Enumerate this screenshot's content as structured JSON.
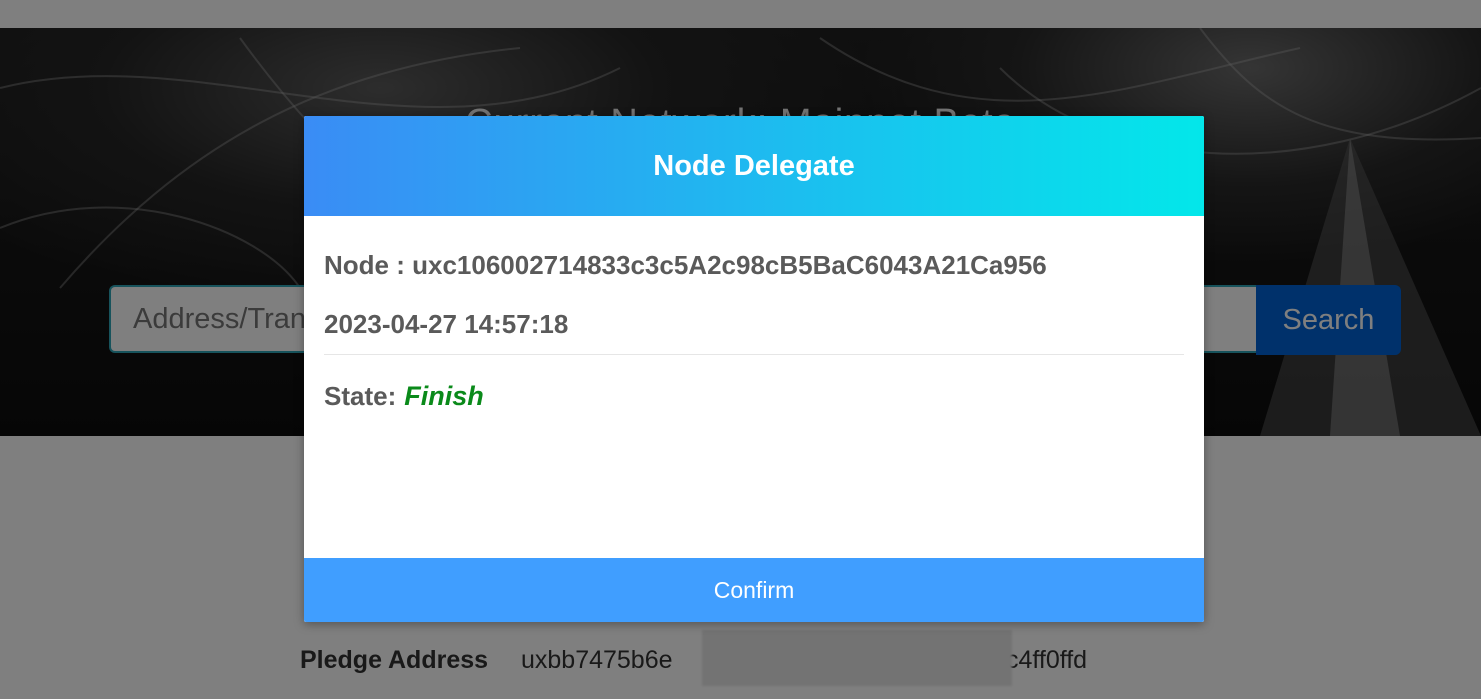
{
  "hero": {
    "title": "Current Network: Mainnet Beta"
  },
  "search": {
    "placeholder": "Address/Transaction Hash/Block Height",
    "button_label": "Search"
  },
  "pledge": {
    "label": "Pledge Address",
    "value_start": "uxbb7475b6e",
    "value_end": "cfc4ff0ffd"
  },
  "modal": {
    "title": "Node Delegate",
    "node_label": "Node :",
    "node_value": "uxc106002714833c3c5A2c98cB5BaC6043A21Ca956",
    "timestamp": "2023-04-27 14:57:18",
    "state_label": "State:",
    "state_value": "Finish",
    "confirm_label": "Confirm"
  }
}
